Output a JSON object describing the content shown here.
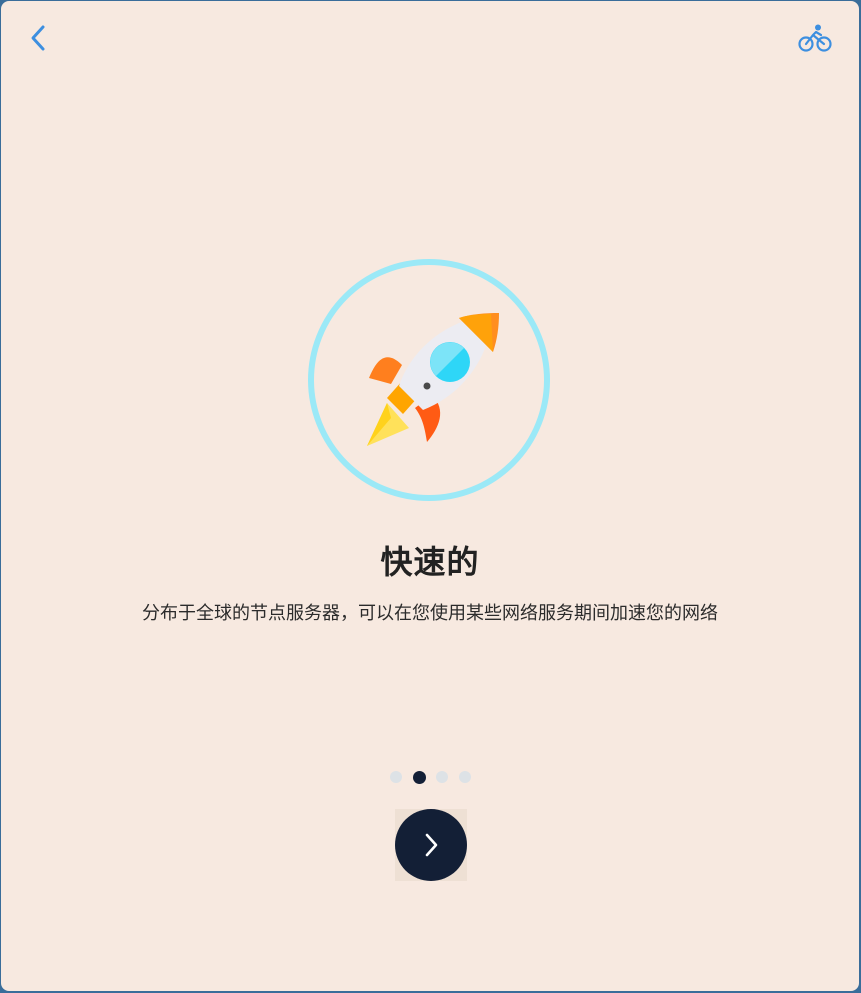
{
  "nav": {
    "back_icon": "chevron-left-icon",
    "right_icon": "bicycle-icon",
    "accent_color": "#3d8fe0"
  },
  "slide": {
    "illustration": "rocket-icon",
    "ring_color": "#9be9f7",
    "title": "快速的",
    "description": "分布于全球的节点服务器，可以在您使用某些网络服务期间加速您的网络"
  },
  "pagination": {
    "total": 4,
    "active_index": 1,
    "active_color": "#131f36",
    "inactive_color": "#dde2e6"
  },
  "next_button": {
    "icon": "chevron-right-icon",
    "background": "#131f36"
  }
}
